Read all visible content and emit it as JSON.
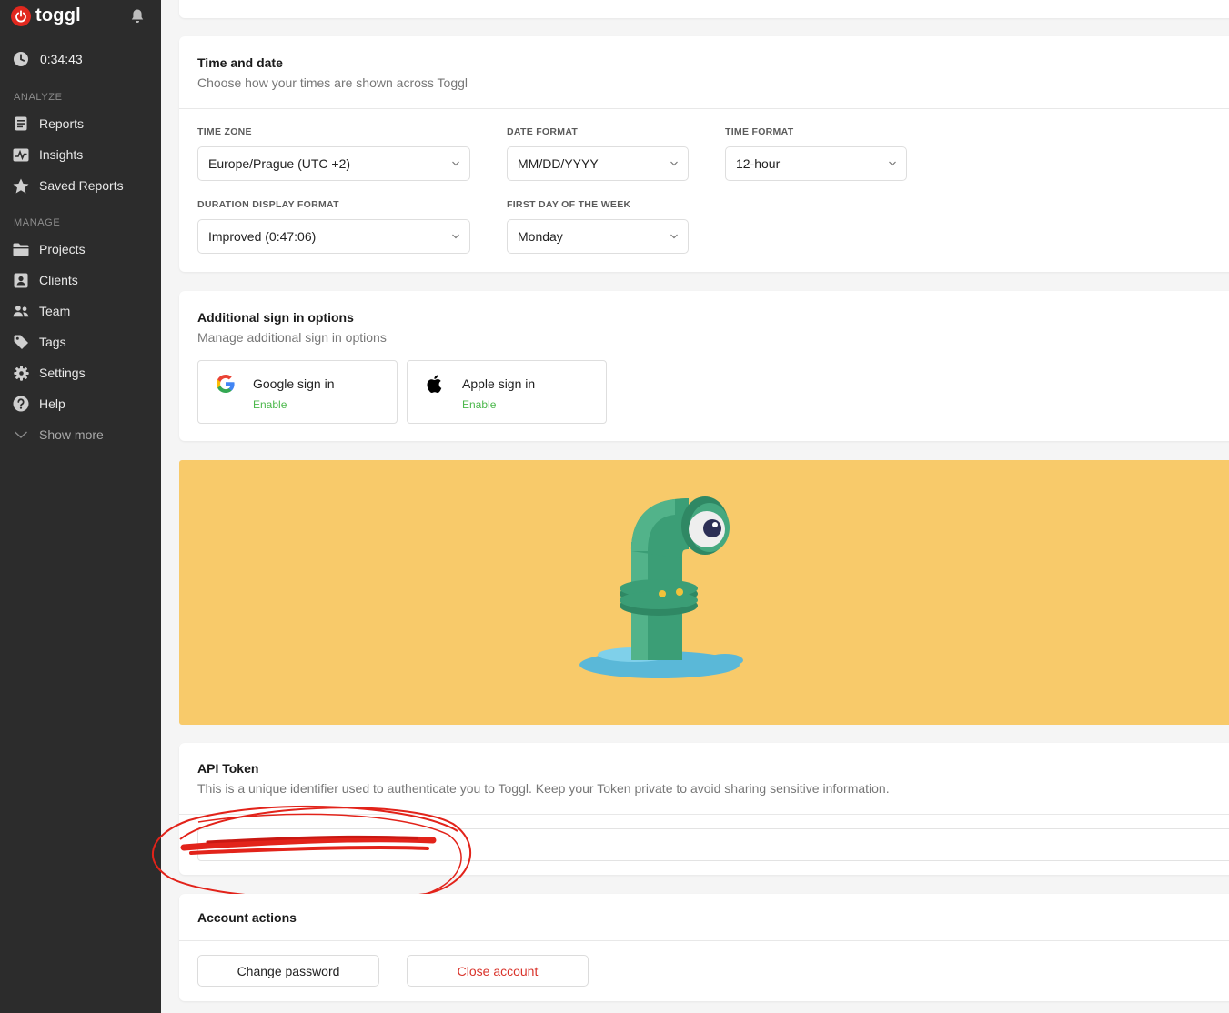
{
  "sidebar": {
    "brand": "toggl",
    "timer": "0:34:43",
    "sections": {
      "analyze": "ANALYZE",
      "manage": "MANAGE"
    },
    "analyze_items": [
      {
        "label": "Reports",
        "icon": "reports-icon"
      },
      {
        "label": "Insights",
        "icon": "insights-icon"
      },
      {
        "label": "Saved Reports",
        "icon": "star-icon"
      }
    ],
    "manage_items": [
      {
        "label": "Projects",
        "icon": "folder-icon"
      },
      {
        "label": "Clients",
        "icon": "client-icon"
      },
      {
        "label": "Team",
        "icon": "team-icon"
      },
      {
        "label": "Tags",
        "icon": "tag-icon"
      },
      {
        "label": "Settings",
        "icon": "gear-icon"
      },
      {
        "label": "Help",
        "icon": "help-icon"
      }
    ],
    "show_more": "Show more"
  },
  "time_and_date": {
    "title": "Time and date",
    "subtitle": "Choose how your times are shown across Toggl",
    "fields": {
      "time_zone": {
        "label": "TIME ZONE",
        "value": "Europe/Prague (UTC +2)"
      },
      "date_format": {
        "label": "DATE FORMAT",
        "value": "MM/DD/YYYY"
      },
      "time_format": {
        "label": "TIME FORMAT",
        "value": "12-hour"
      },
      "duration_format": {
        "label": "DURATION DISPLAY FORMAT",
        "value": "Improved (0:47:06)"
      },
      "first_day": {
        "label": "FIRST DAY OF THE WEEK",
        "value": "Monday"
      }
    }
  },
  "sign_in": {
    "title": "Additional sign in options",
    "subtitle": "Manage additional sign in options",
    "google": {
      "title": "Google sign in",
      "action": "Enable"
    },
    "apple": {
      "title": "Apple sign in",
      "action": "Enable"
    }
  },
  "api_token": {
    "title": "API Token",
    "subtitle": "This is a unique identifier used to authenticate you to Toggl. Keep your Token private to avoid sharing sensitive information."
  },
  "account_actions": {
    "title": "Account actions",
    "change_password": "Change password",
    "close_account": "Close account"
  },
  "colors": {
    "sidebar_bg": "#2c2c2c",
    "brand_red": "#e1281e",
    "enable_green": "#4cb84c",
    "banner_yellow": "#f8ca6a",
    "danger_red": "#d9332b"
  }
}
